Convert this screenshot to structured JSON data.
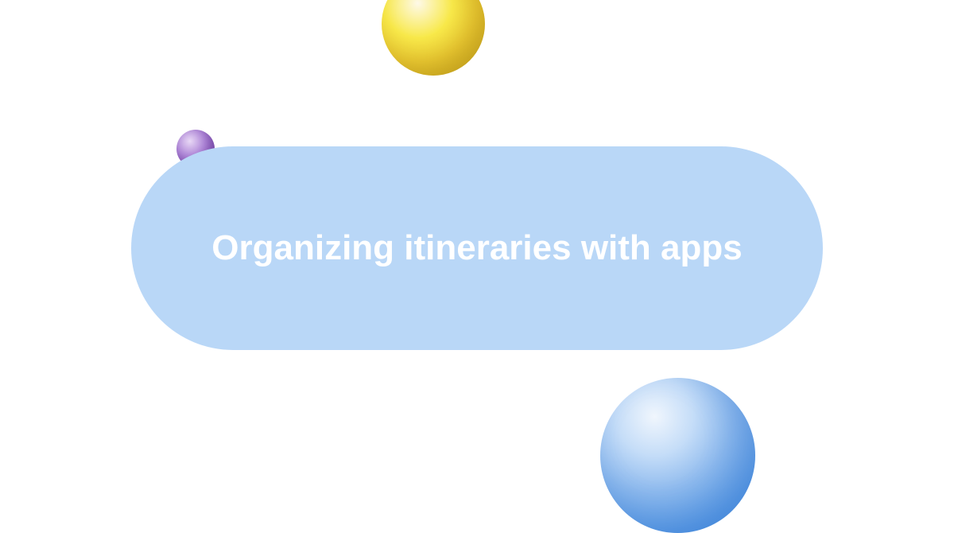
{
  "title": "Organizing itineraries with apps"
}
